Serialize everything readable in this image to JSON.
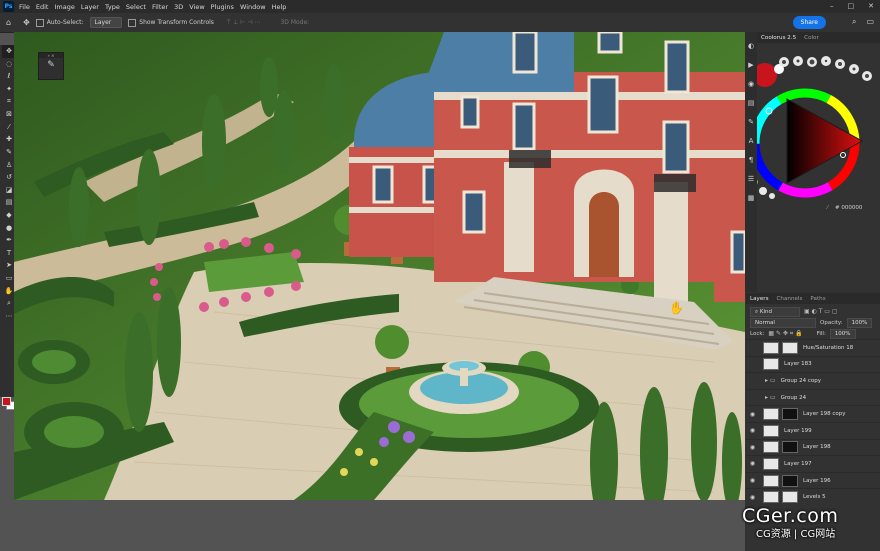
{
  "app": {
    "logo": "Ps"
  },
  "menubar": {
    "items": [
      "File",
      "Edit",
      "Image",
      "Layer",
      "Type",
      "Select",
      "Filter",
      "3D",
      "View",
      "Plugins",
      "Window",
      "Help"
    ],
    "window_controls": [
      "minimize-icon",
      "maximize-icon",
      "close-icon"
    ]
  },
  "options_bar": {
    "auto_select_label": "Auto-Select:",
    "auto_select_target": "Layer",
    "show_transform_label": "Show Transform Controls",
    "mode_3d_label": "3D Mode:",
    "share_label": "Share"
  },
  "toolbar": {
    "tools": [
      "move-icon",
      "marquee-icon",
      "lasso-icon",
      "magic-wand-icon",
      "crop-icon",
      "frame-icon",
      "eyedropper-icon",
      "healing-icon",
      "brush-icon",
      "clone-stamp-icon",
      "history-brush-icon",
      "eraser-icon",
      "gradient-icon",
      "blur-icon",
      "dodge-icon",
      "pen-icon",
      "type-icon",
      "path-select-icon",
      "rectangle-icon",
      "hand-icon",
      "zoom-icon",
      "more-tools-icon"
    ],
    "foreground_color": "#c8141c",
    "background_color": "#ffffff"
  },
  "color_panel": {
    "tabs": [
      "Coolorus 2.5",
      "Color"
    ],
    "hex_value": "# 000000",
    "current_color": "#c8141c"
  },
  "layers_panel": {
    "tabs": [
      "Layers",
      "Channels",
      "Paths"
    ],
    "filter_kind": "Kind",
    "blend_mode": "Normal",
    "opacity_label": "Opacity:",
    "opacity_value": "100%",
    "lock_label": "Lock:",
    "fill_label": "Fill:",
    "fill_value": "100%",
    "layers": [
      {
        "name": "Hue/Saturation 18",
        "visible": false,
        "type": "adjustment"
      },
      {
        "name": "Layer 183",
        "visible": false,
        "type": "pixel"
      },
      {
        "name": "Group 24 copy",
        "visible": false,
        "type": "group"
      },
      {
        "name": "Group 24",
        "visible": false,
        "type": "group"
      },
      {
        "name": "Layer 198 copy",
        "visible": true,
        "type": "pixel-mask"
      },
      {
        "name": "Layer 199",
        "visible": true,
        "type": "pixel"
      },
      {
        "name": "Layer 198",
        "visible": true,
        "type": "pixel-mask"
      },
      {
        "name": "Layer 197",
        "visible": true,
        "type": "pixel"
      },
      {
        "name": "Layer 196",
        "visible": true,
        "type": "pixel-mask"
      },
      {
        "name": "Levels 5",
        "visible": true,
        "type": "adjustment"
      }
    ]
  },
  "watermark": {
    "main": "CGer.com",
    "sub": "CG资源 | CG网站"
  }
}
